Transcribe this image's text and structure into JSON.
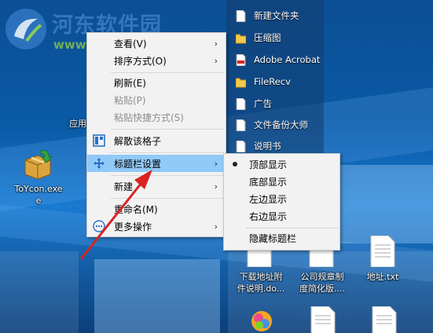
{
  "watermark": {
    "site_name": "河东软件园",
    "url": "www.pc0359.cn"
  },
  "desktop": {
    "partial_label": "应用",
    "toycon_label_line1": "ToYcon.exe",
    "toycon_label_line2": "e"
  },
  "fence_items": [
    {
      "label": "新建文件夹",
      "icon": "document-icon"
    },
    {
      "label": "压缩图",
      "icon": "folder-icon"
    },
    {
      "label": "Adobe Acrobat",
      "icon": "pdf-icon"
    },
    {
      "label": "FileRecv",
      "icon": "folder-icon"
    },
    {
      "label": "广告",
      "icon": "document-icon"
    },
    {
      "label": "文件备份大师",
      "icon": "document-icon"
    },
    {
      "label": "说明书",
      "icon": "document-icon"
    }
  ],
  "context_menu": {
    "view": "查看(V)",
    "sort": "排序方式(O)",
    "refresh": "刷新(E)",
    "paste": "粘贴(P)",
    "paste_shortcut": "粘贴快捷方式(S)",
    "dissolve": "解散该格子",
    "titlebar": "标题栏设置",
    "new": "新建",
    "rename": "重命名(M)",
    "more": "更多操作"
  },
  "submenu": {
    "top": "顶部显示",
    "bottom": "底部显示",
    "left": "左边显示",
    "right": "右边显示",
    "hide": "隐藏标题栏",
    "selected": "顶部显示"
  },
  "desktop_files": [
    {
      "line1": "下载地址附",
      "line2": "件说明.do..."
    },
    {
      "line1": "公司规章制",
      "line2": "度简化版...."
    },
    {
      "line1": "地址.txt",
      "line2": ""
    }
  ],
  "colors": {
    "menu_highlight": "#91c9f7",
    "annotation_arrow": "#d9241f"
  }
}
